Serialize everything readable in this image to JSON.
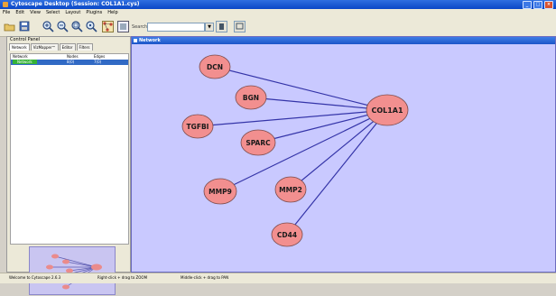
{
  "window": {
    "title": "Cytoscape Desktop (Session: COL1A1.cys)"
  },
  "menu": [
    "File",
    "Edit",
    "View",
    "Select",
    "Layout",
    "Plugins",
    "Help"
  ],
  "toolbar": {
    "icons": [
      "open-icon",
      "save-icon",
      "zoom-in-icon",
      "zoom-out-icon",
      "zoom-fit-icon",
      "zoom-selected-icon",
      "network-icon",
      "vizmapper-icon"
    ],
    "search_label": "Search:",
    "search_value": "",
    "search_dropdown": "▼"
  },
  "control_panel": {
    "title": "Control Panel",
    "tabs": [
      "Network",
      "VizMapper™",
      "Editor",
      "Filters"
    ],
    "columns": [
      "Network",
      "Nodes",
      "Edges"
    ],
    "rows": [
      {
        "name": "Network",
        "nodes": "8(0)",
        "edges": "7(0)"
      }
    ]
  },
  "network_window": {
    "title": "Network"
  },
  "graph": {
    "nodes": [
      {
        "id": "COL1A1",
        "label": "COL1A1"
      },
      {
        "id": "DCN",
        "label": "DCN"
      },
      {
        "id": "BGN",
        "label": "BGN"
      },
      {
        "id": "TGFBI",
        "label": "TGFBI"
      },
      {
        "id": "SPARC",
        "label": "SPARC"
      },
      {
        "id": "MMP9",
        "label": "MMP9"
      },
      {
        "id": "MMP2",
        "label": "MMP2"
      },
      {
        "id": "CD44",
        "label": "CD44"
      }
    ],
    "edges": [
      [
        "DCN",
        "COL1A1"
      ],
      [
        "BGN",
        "COL1A1"
      ],
      [
        "TGFBI",
        "COL1A1"
      ],
      [
        "SPARC",
        "COL1A1"
      ],
      [
        "MMP9",
        "COL1A1"
      ],
      [
        "MMP2",
        "COL1A1"
      ],
      [
        "CD44",
        "COL1A1"
      ]
    ],
    "node_color": "#f28f8f",
    "edge_color": "#3434a8",
    "background_color": "#c9c9ff"
  },
  "status_bar": {
    "left": "Welcome to Cytoscape 2.6.3",
    "middle": "Right-click + drag to ZOOM",
    "right": "Middle-click + drag to PAN"
  }
}
